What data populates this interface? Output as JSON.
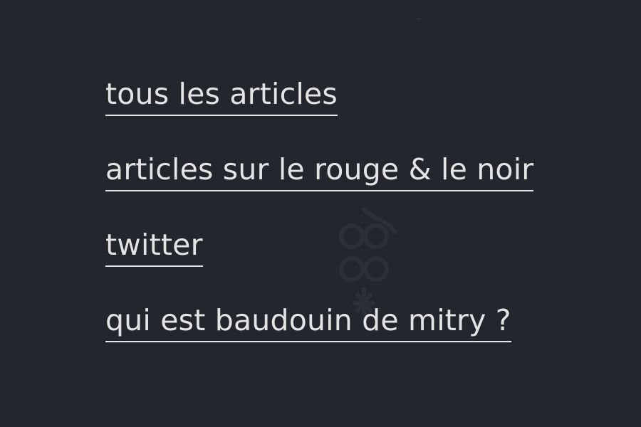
{
  "menu": {
    "items": [
      {
        "label": "tous les articles"
      },
      {
        "label": "articles sur le rouge & le noir"
      },
      {
        "label": "twitter"
      },
      {
        "label": "qui est baudouin de mitry ?"
      }
    ]
  },
  "colors": {
    "background": "#23262d",
    "link_text": "#e4e4e4",
    "watermark": "#2b2f36"
  },
  "icons": {
    "watermark": "monogram-logo-icon"
  }
}
